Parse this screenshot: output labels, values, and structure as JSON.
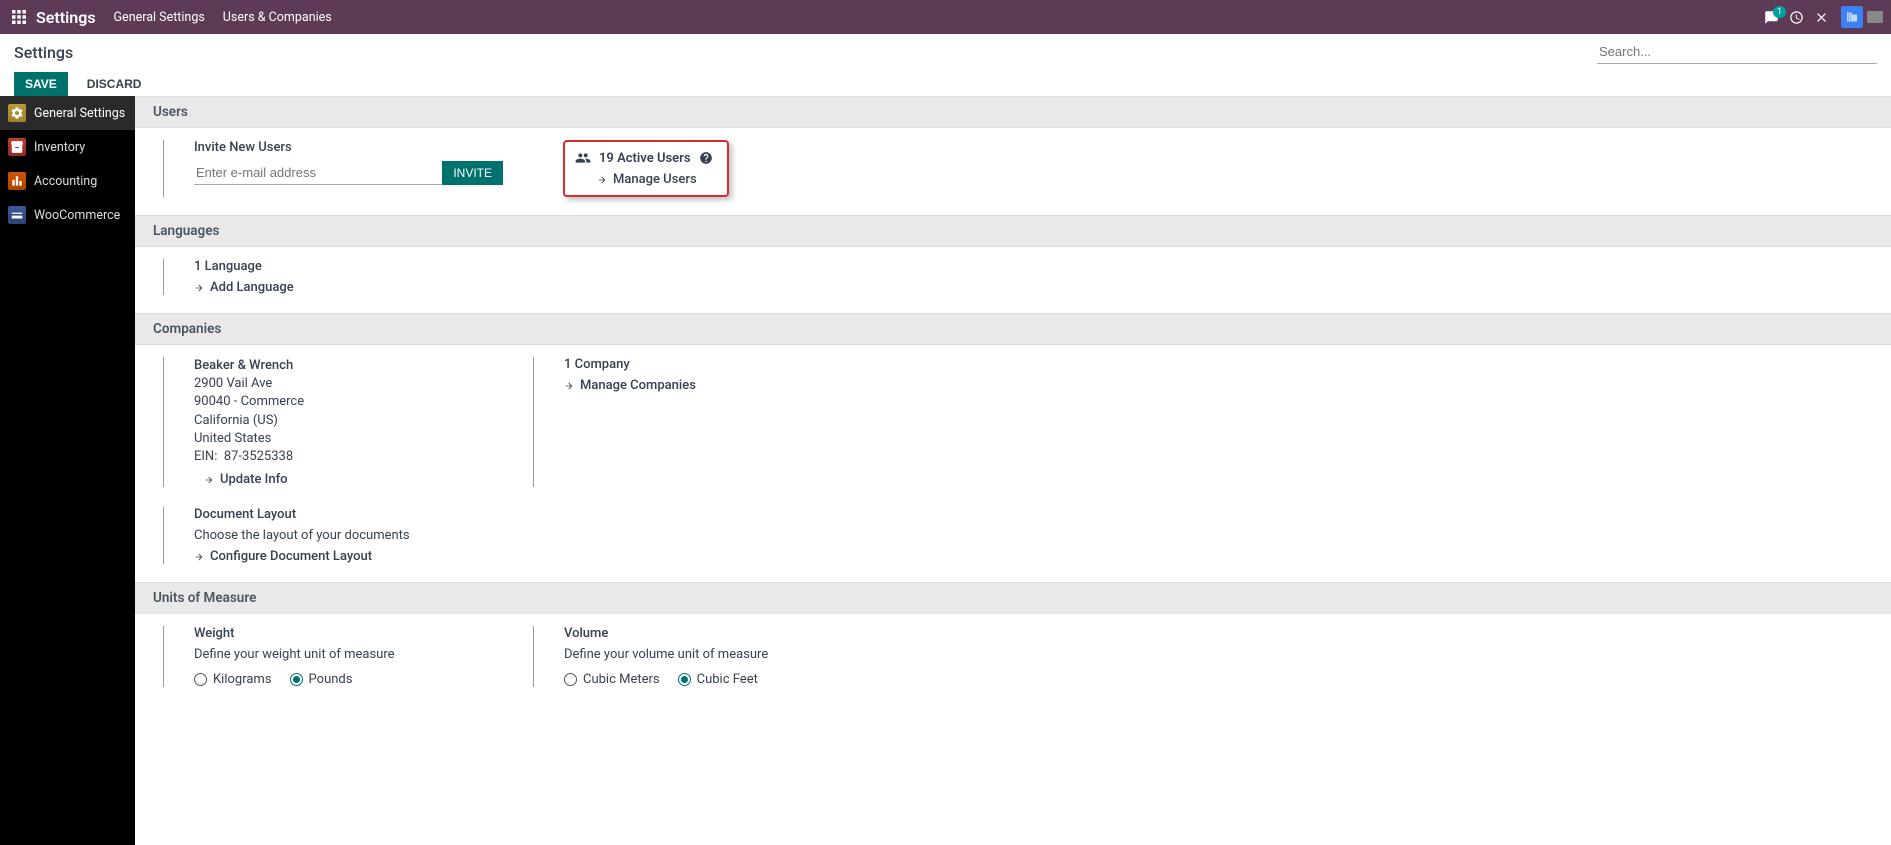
{
  "topbar": {
    "app_title": "Settings",
    "menu1": "General Settings",
    "menu2": "Users & Companies",
    "msg_badge": "1"
  },
  "controlbar": {
    "breadcrumb": "Settings",
    "save": "SAVE",
    "discard": "DISCARD",
    "search_placeholder": "Search..."
  },
  "sidebar": {
    "items": [
      {
        "label": "General Settings"
      },
      {
        "label": "Inventory"
      },
      {
        "label": "Accounting"
      },
      {
        "label": "WooCommerce"
      }
    ]
  },
  "sections": {
    "users": {
      "title": "Users",
      "invite_label": "Invite New Users",
      "email_placeholder": "Enter e-mail address",
      "invite_btn": "INVITE",
      "active_users": "19 Active Users",
      "manage_users": "Manage Users"
    },
    "languages": {
      "title": "Languages",
      "count": "1 Language",
      "add": "Add Language"
    },
    "companies": {
      "title": "Companies",
      "name": "Beaker & Wrench",
      "addr1": "2900 Vail Ave",
      "addr2": "90040 - Commerce",
      "state": "California (US)",
      "country": "United States",
      "ein_label": "EIN:",
      "ein": "87-3525338",
      "update": "Update Info",
      "doc_layout": "Document Layout",
      "doc_layout_sub": "Choose the layout of your documents",
      "configure": "Configure Document Layout",
      "count": "1 Company",
      "manage": "Manage Companies"
    },
    "units": {
      "title": "Units of Measure",
      "weight": "Weight",
      "weight_sub": "Define your weight unit of measure",
      "kg": "Kilograms",
      "lb": "Pounds",
      "volume": "Volume",
      "volume_sub": "Define your volume unit of measure",
      "m3": "Cubic Meters",
      "ft3": "Cubic Feet"
    }
  }
}
